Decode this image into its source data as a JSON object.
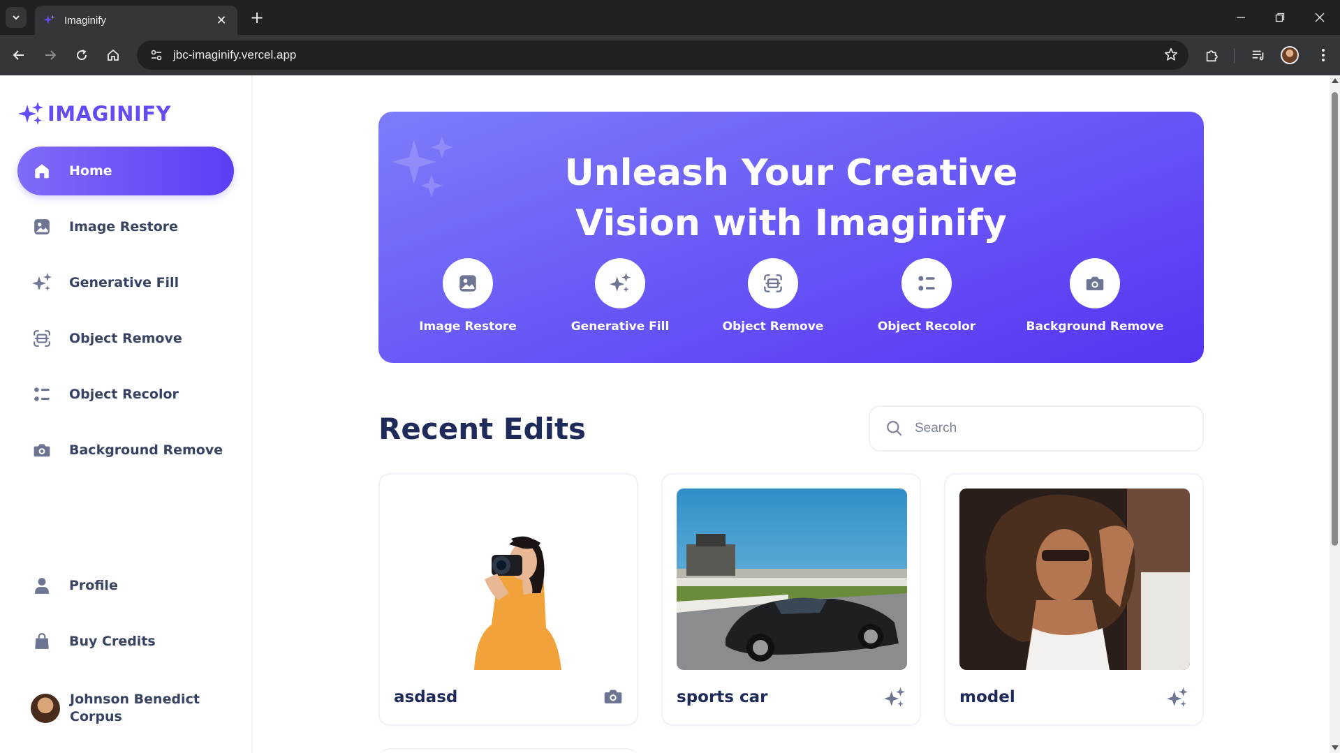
{
  "browser": {
    "tab_title": "Imaginify",
    "url": "jbc-imaginify.vercel.app"
  },
  "sidebar": {
    "logo_text": "IMAGINIFY",
    "nav_items": [
      {
        "label": "Home",
        "icon": "home-icon",
        "active": true
      },
      {
        "label": "Image Restore",
        "icon": "image-icon"
      },
      {
        "label": "Generative Fill",
        "icon": "sparkles-icon"
      },
      {
        "label": "Object Remove",
        "icon": "scan-icon"
      },
      {
        "label": "Object Recolor",
        "icon": "filter-icon"
      },
      {
        "label": "Background Remove",
        "icon": "camera-icon"
      }
    ],
    "bottom_items": [
      {
        "label": "Profile",
        "icon": "profile-icon"
      },
      {
        "label": "Buy Credits",
        "icon": "bag-icon"
      }
    ],
    "user_name": "Johnson Benedict Corpus"
  },
  "hero": {
    "title_line1": "Unleash Your Creative",
    "title_line2": "Vision with Imaginify",
    "features": [
      {
        "label": "Image Restore",
        "icon": "image-icon"
      },
      {
        "label": "Generative Fill",
        "icon": "sparkles-icon"
      },
      {
        "label": "Object Remove",
        "icon": "scan-icon"
      },
      {
        "label": "Object Recolor",
        "icon": "filter-icon"
      },
      {
        "label": "Background Remove",
        "icon": "camera-icon"
      }
    ]
  },
  "recent": {
    "title": "Recent Edits",
    "search_placeholder": "Search",
    "cards": [
      {
        "title": "asdasd",
        "icon": "camera-icon"
      },
      {
        "title": "sports car",
        "icon": "sparkles-icon"
      },
      {
        "title": "model",
        "icon": "sparkles-icon"
      }
    ]
  },
  "colors": {
    "brand": "#624cf5",
    "text_dark": "#1d2a5a",
    "text": "#384262"
  }
}
